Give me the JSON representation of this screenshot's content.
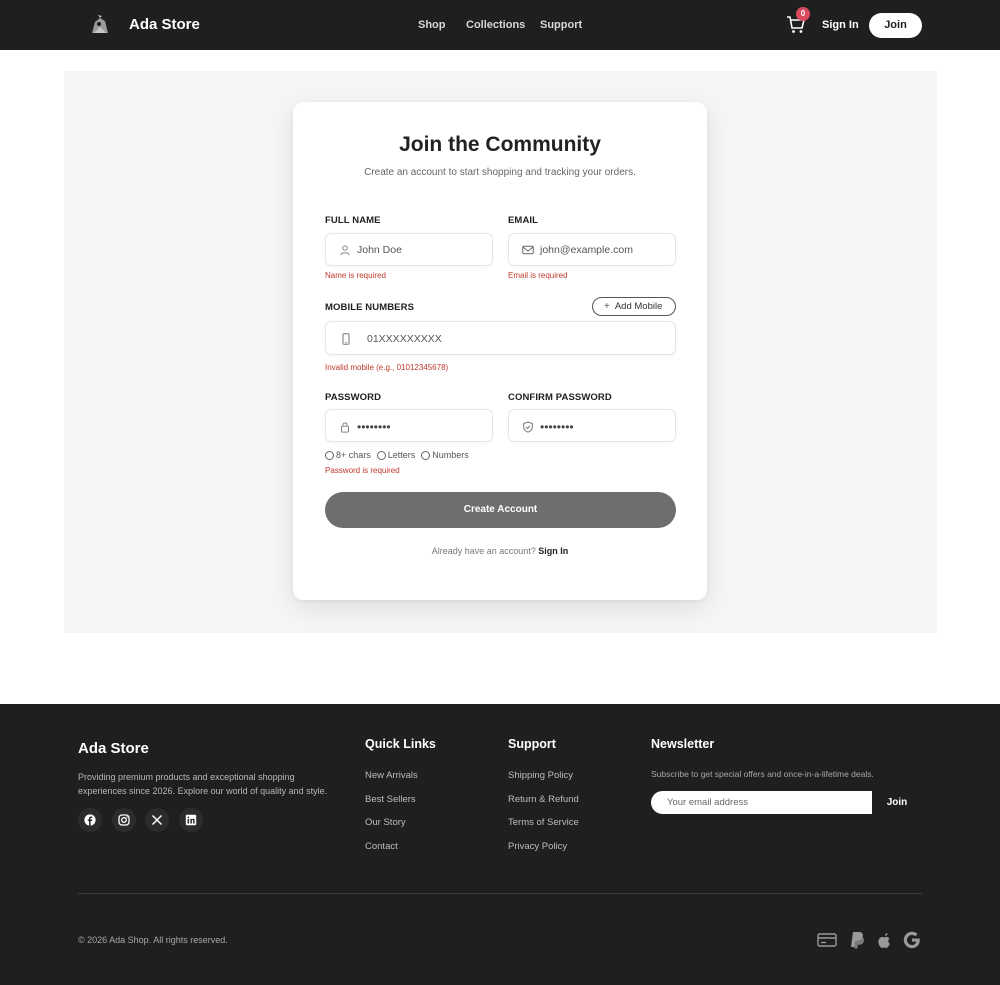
{
  "header": {
    "brand": "Ada Store",
    "nav": [
      "Shop",
      "Collections",
      "Support"
    ],
    "cart_count": "0",
    "signin_label": "Sign In",
    "join_label": "Join"
  },
  "form": {
    "title": "Join the Community",
    "subtitle": "Create an account to start shopping and tracking your orders.",
    "full_name": {
      "label": "FULL NAME",
      "placeholder": "John Doe",
      "error": "Name is required"
    },
    "email": {
      "label": "EMAIL",
      "placeholder": "john@example.com",
      "error": "Email is required"
    },
    "mobile": {
      "label": "MOBILE NUMBERS",
      "add_label": "Add Mobile",
      "placeholder": "01XXXXXXXXX",
      "error": "Invalid mobile (e.g., 01012345678)"
    },
    "password": {
      "label": "PASSWORD",
      "value": "••••••••",
      "error": "Password is required"
    },
    "confirm_password": {
      "label": "CONFIRM PASSWORD",
      "value": "••••••••"
    },
    "requirements": [
      "8+ chars",
      "Letters",
      "Numbers"
    ],
    "submit_label": "Create Account",
    "already_text": "Already have an account?",
    "signin_link": "Sign In"
  },
  "footer": {
    "brand": "Ada Store",
    "description": "Providing premium products and exceptional shopping experiences since 2026. Explore our world of quality and style.",
    "social_icons": [
      "facebook-icon",
      "instagram-icon",
      "x-icon",
      "linkedin-icon"
    ],
    "quick_links": {
      "title": "Quick Links",
      "items": [
        "New Arrivals",
        "Best Sellers",
        "Our Story",
        "Contact"
      ]
    },
    "support": {
      "title": "Support",
      "items": [
        "Shipping Policy",
        "Return & Refund",
        "Terms of Service",
        "Privacy Policy"
      ]
    },
    "newsletter": {
      "title": "Newsletter",
      "description": "Subscribe to get special offers and once-in-a-lifetime deals.",
      "placeholder": "Your email address",
      "button": "Join"
    },
    "copyright": "© 2026 Ada Shop. All rights reserved.",
    "payment_icons": [
      "card-icon",
      "paypal-icon",
      "apple-icon",
      "google-icon"
    ]
  },
  "colors": {
    "header_bg": "#1f1f1f",
    "accent": "#6e6e6e",
    "error": "#c0392b",
    "badge": "#d94a5e"
  }
}
